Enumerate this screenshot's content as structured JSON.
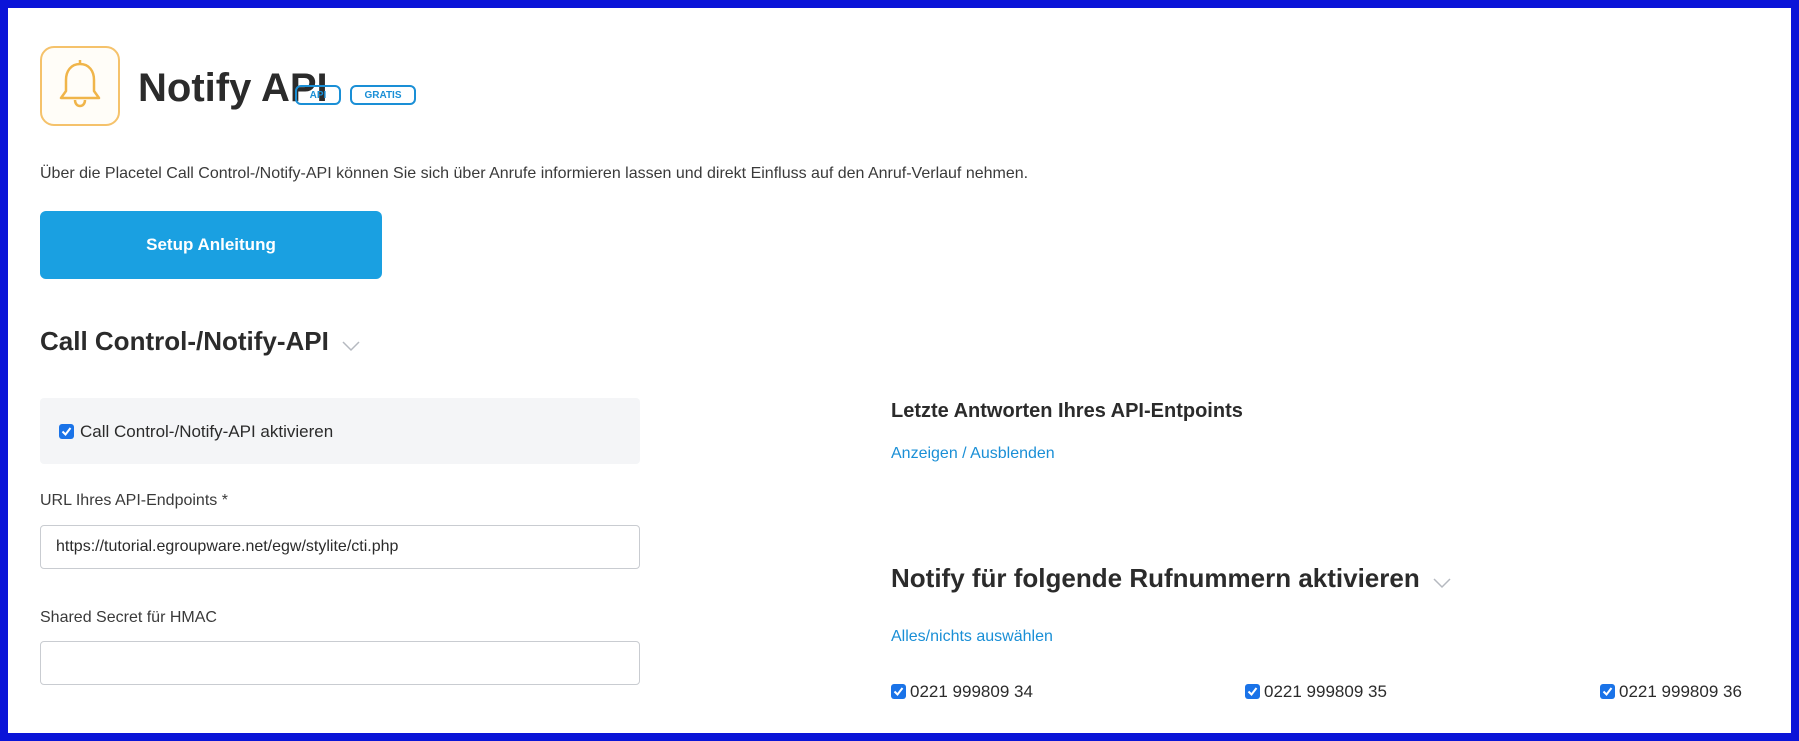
{
  "header": {
    "title": "Notify API",
    "badges": [
      "API",
      "GRATIS"
    ],
    "icon": "bell-icon"
  },
  "description": "Über die Placetel Call Control-/Notify-API können Sie sich über Anrufe informieren lassen und direkt Einfluss auf den Anruf-Verlauf nehmen.",
  "setup_button": {
    "label": "Setup Anleitung"
  },
  "section_api": {
    "title": "Call Control-/Notify-API",
    "activate_checkbox": {
      "label": "Call Control-/Notify-API aktivieren",
      "checked": true
    },
    "url_field": {
      "label": "URL Ihres API-Endpoints *",
      "value": "https://tutorial.egroupware.net/egw/stylite/cti.php"
    },
    "secret_field": {
      "label": "Shared Secret für HMAC",
      "value": ""
    }
  },
  "responses": {
    "title": "Letzte Antworten Ihres API-Entpoints",
    "toggle_link": "Anzeigen / Ausblenden"
  },
  "section_numbers": {
    "title": "Notify für folgende Rufnummern aktivieren",
    "select_all_link": "Alles/nichts auswählen",
    "numbers": [
      {
        "label": "0221 999809 34",
        "checked": true
      },
      {
        "label": "0221 999809 35",
        "checked": true
      },
      {
        "label": "0221 999809 36",
        "checked": true
      }
    ]
  },
  "colors": {
    "frame": "#0a14d8",
    "accent": "#1aa0e1",
    "link": "#1a8fd6",
    "checkbox": "#1a73e8",
    "icon_border": "#f5c26b"
  }
}
